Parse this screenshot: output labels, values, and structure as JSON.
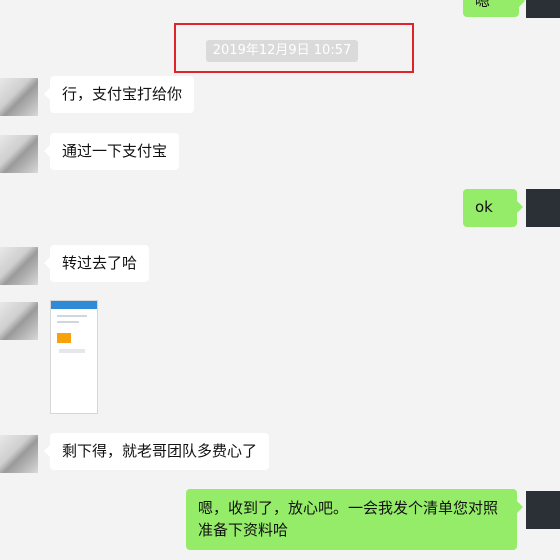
{
  "timestamp": "2019年12月9日 10:57",
  "messages": [
    {
      "side": "right",
      "text": "嗯"
    },
    {
      "side": "left",
      "text": "行，支付宝打给你"
    },
    {
      "side": "left",
      "text": "通过一下支付宝"
    },
    {
      "side": "right",
      "text": "ok"
    },
    {
      "side": "left",
      "text": "转过去了哈"
    },
    {
      "side": "left",
      "type": "image"
    },
    {
      "side": "left",
      "text": "剩下得，就老哥团队多费心了"
    },
    {
      "side": "right",
      "text": "嗯，收到了，放心吧。一会我发个清单您对照准备下资料哈"
    }
  ],
  "colors": {
    "own_bubble": "#95ec69",
    "other_bubble": "#ffffff",
    "highlight_box": "#e0232a",
    "background": "#f3f3f3"
  }
}
